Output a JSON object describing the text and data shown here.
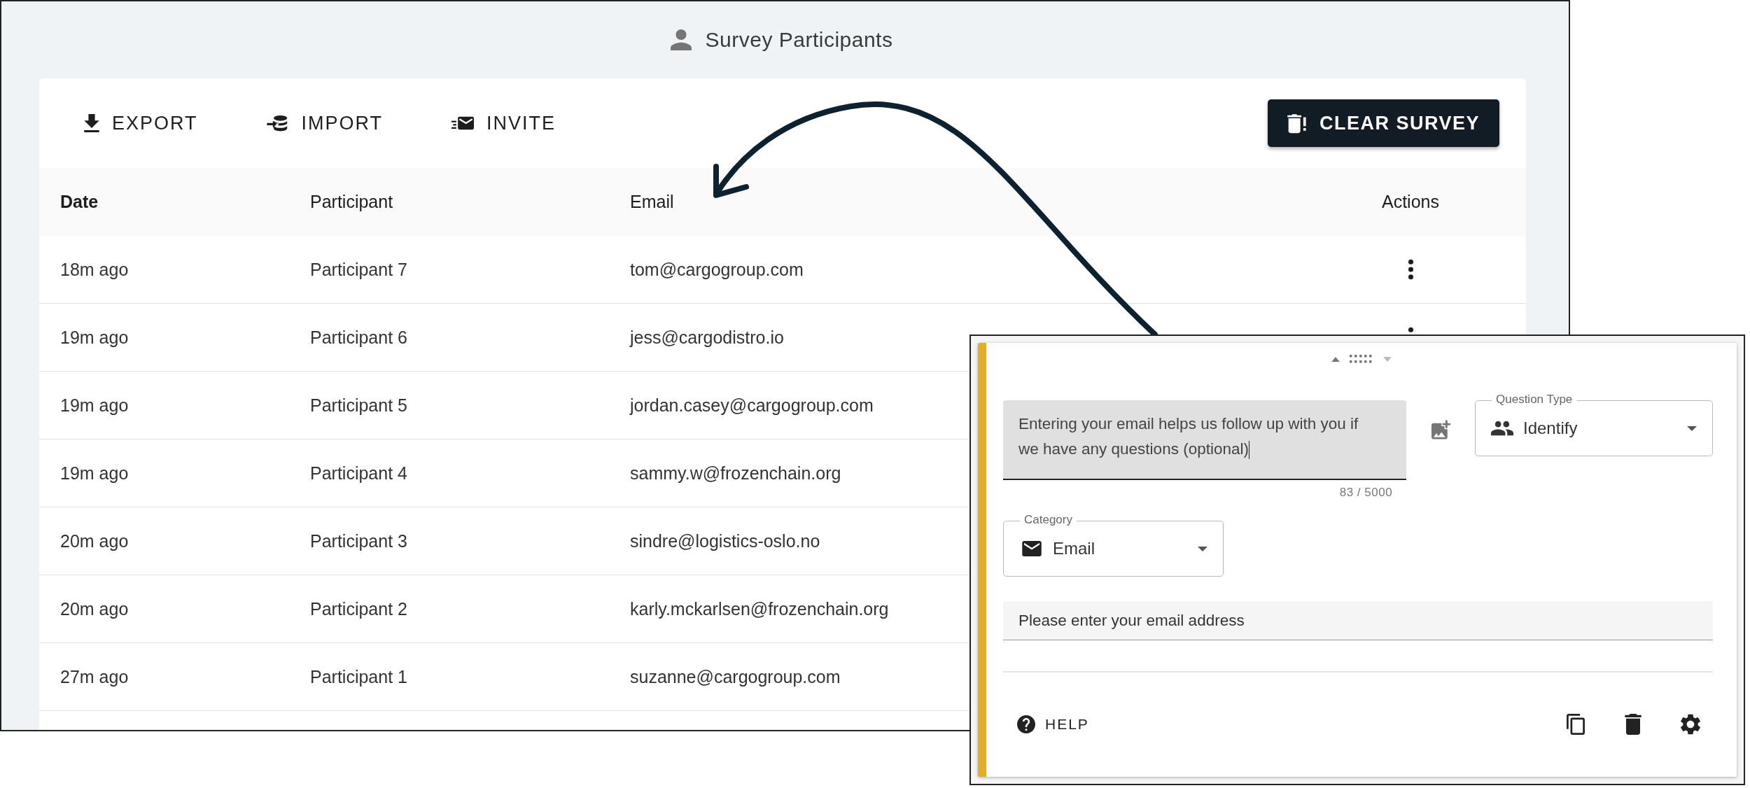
{
  "header": {
    "title": "Survey Participants"
  },
  "toolbar": {
    "actions": [
      {
        "label": "EXPORT",
        "kind": "export"
      },
      {
        "label": "IMPORT",
        "kind": "import"
      },
      {
        "label": "INVITE",
        "kind": "invite"
      }
    ],
    "clear_button": {
      "label": "CLEAR SURVEY"
    }
  },
  "table": {
    "columns": [
      "Date",
      "Participant",
      "Email",
      "Actions"
    ],
    "rows": [
      {
        "date": "18m ago",
        "participant": "Participant 7",
        "email": "tom@cargogroup.com"
      },
      {
        "date": "19m ago",
        "participant": "Participant 6",
        "email": "jess@cargodistro.io"
      },
      {
        "date": "19m ago",
        "participant": "Participant 5",
        "email": "jordan.casey@cargogroup.com"
      },
      {
        "date": "19m ago",
        "participant": "Participant 4",
        "email": "sammy.w@frozenchain.org"
      },
      {
        "date": "20m ago",
        "participant": "Participant 3",
        "email": "sindre@logistics-oslo.no"
      },
      {
        "date": "20m ago",
        "participant": "Participant 2",
        "email": "karly.mckarlsen@frozenchain.org"
      },
      {
        "date": "27m ago",
        "participant": "Participant 1",
        "email": "suzanne@cargogroup.com"
      }
    ]
  },
  "question_card": {
    "question": "Entering your email helps us follow up with you if we have any questions (optional)",
    "counter": "83 / 5000",
    "question_type": {
      "label": "Question Type",
      "value": "Identify"
    },
    "category": {
      "label": "Category",
      "value": "Email"
    },
    "answer_preview": "Please enter your email address",
    "help_button": {
      "label": "HELP"
    }
  }
}
